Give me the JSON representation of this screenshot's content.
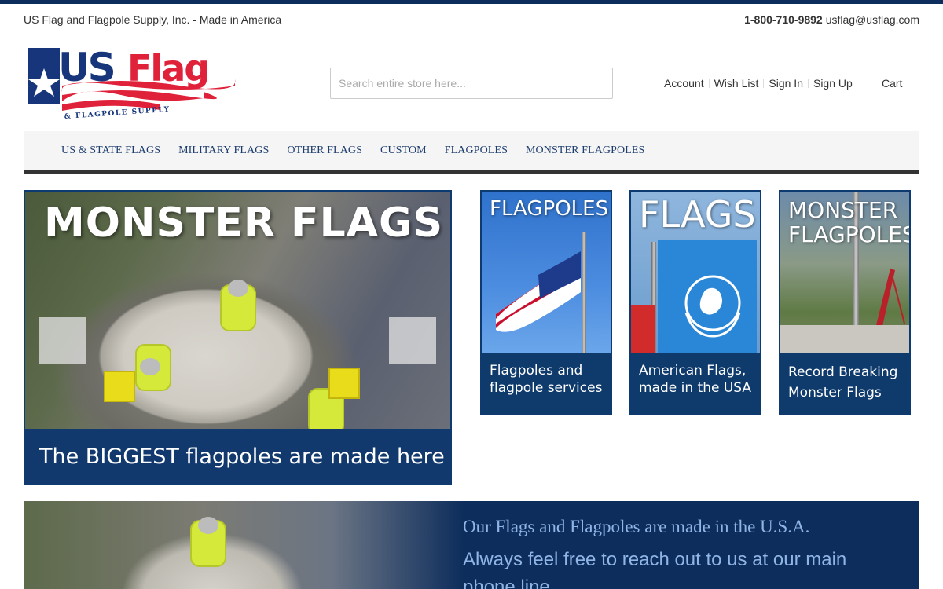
{
  "colors": {
    "brand_navy": "#0d2d5c",
    "nav_text": "#1d3d6e",
    "logo_red": "#e0213a",
    "caption_blue": "#12396d"
  },
  "header": {
    "tagline": "US Flag and Flagpole Supply, Inc. - Made in America",
    "phone": "1-800-710-9892",
    "email": "usflag@usflag.com"
  },
  "logo": {
    "main": "USFlag",
    "us": "US",
    "flag": "Flag",
    "sub": "& FLAGPOLE SUPPLY",
    "icon": "star-icon"
  },
  "search": {
    "placeholder": "Search entire store here..."
  },
  "account": {
    "account": "Account",
    "wishlist": "Wish List",
    "signin": "Sign In",
    "signup": "Sign Up",
    "cart": "Cart"
  },
  "nav": {
    "items": [
      "US & STATE FLAGS",
      "MILITARY FLAGS",
      "OTHER FLAGS",
      "CUSTOM",
      "FLAGPOLES",
      "MONSTER FLAGPOLES"
    ]
  },
  "hero": {
    "title": "MONSTER FLAGS",
    "caption": "The BIGGEST flagpoles are made here",
    "prev_icon": "chevron-left-icon",
    "next_icon": "chevron-right-icon"
  },
  "tiles": [
    {
      "heading": "FLAGPOLES",
      "caption_line1": "Flagpoles and",
      "caption_line2": "flagpole services"
    },
    {
      "heading": "FLAGS",
      "caption_line1": "American Flags,",
      "caption_line2": "made in the USA"
    },
    {
      "heading_line1": "MONSTER",
      "heading_line2": "FLAGPOLES",
      "caption_line1": "Record Breaking",
      "caption_line2": "Monster Flags"
    }
  ],
  "banner": {
    "line1": "Our Flags and Flagpoles are made in the U.S.A.",
    "line2": "Always feel free to reach out to us at our main phone line"
  }
}
